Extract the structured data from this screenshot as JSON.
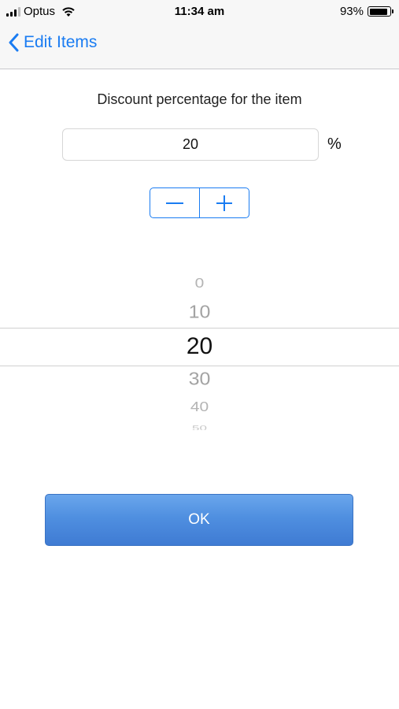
{
  "status_bar": {
    "carrier": "Optus",
    "time": "11:34 am",
    "battery_percent": "93%",
    "battery_level": 0.93,
    "wifi_icon": "wifi-icon",
    "signal_icon": "cellular-signal-icon"
  },
  "nav": {
    "back_label": "Edit Items",
    "back_icon": "chevron-left-icon",
    "accent_color": "#1a7cf2"
  },
  "form": {
    "prompt": "Discount percentage for the item",
    "value": "20",
    "unit": "%",
    "stepper": {
      "decrement_icon": "minus-icon",
      "increment_icon": "plus-icon"
    }
  },
  "picker": {
    "options": [
      "0",
      "10",
      "20",
      "30",
      "40",
      "50"
    ],
    "selected": "20"
  },
  "ok_button": {
    "label": "OK"
  }
}
